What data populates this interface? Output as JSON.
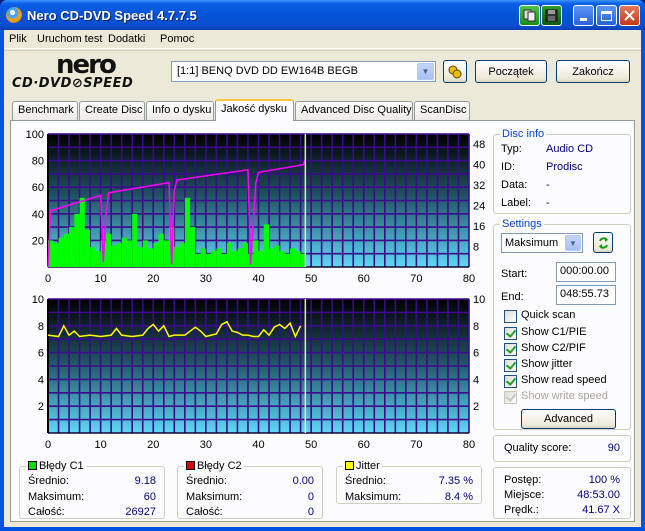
{
  "window": {
    "title": "Nero CD-DVD Speed 4.7.7.5",
    "buttons": [
      "copy",
      "save",
      "minimize",
      "maximize",
      "close"
    ]
  },
  "menu": [
    "Plik",
    "Uruchom test",
    "Dodatki",
    "Pomoc"
  ],
  "logo": {
    "brand": "nero",
    "product": "CD·DVD⊘SPEED"
  },
  "toolbar": {
    "drive": "[1:1]  BENQ DVD DD EW164B BEGB",
    "start_label": "Początek",
    "exit_label": "Zakończ"
  },
  "tabs": [
    {
      "label": "Benchmark",
      "active": false
    },
    {
      "label": "Create Disc",
      "active": false
    },
    {
      "label": "Info o dysku",
      "active": false
    },
    {
      "label": "Jakość dysku",
      "active": true
    },
    {
      "label": "Advanced Disc Quality",
      "active": false
    },
    {
      "label": "ScanDisc",
      "active": false
    }
  ],
  "disc_info": {
    "title": "Disc info",
    "rows": [
      {
        "label": "Typ:",
        "value": "Audio CD"
      },
      {
        "label": "ID:",
        "value": "Prodisc"
      },
      {
        "label": "Data:",
        "value": "-"
      },
      {
        "label": "Label:",
        "value": "-"
      }
    ]
  },
  "settings": {
    "title": "Settings",
    "speed": "Maksimum",
    "start_label": "Start:",
    "start_value": "000:00.00",
    "end_label": "End:",
    "end_value": "048:55.73",
    "checkboxes": [
      {
        "label": "Quick scan",
        "checked": false,
        "disabled": false
      },
      {
        "label": "Show C1/PIE",
        "checked": true,
        "disabled": false
      },
      {
        "label": "Show C2/PIF",
        "checked": true,
        "disabled": false
      },
      {
        "label": "Show jitter",
        "checked": true,
        "disabled": false
      },
      {
        "label": "Show read speed",
        "checked": true,
        "disabled": false
      },
      {
        "label": "Show write speed",
        "checked": true,
        "disabled": true
      }
    ],
    "advanced_label": "Advanced"
  },
  "quality": {
    "label": "Quality score:",
    "value": "90"
  },
  "progress": {
    "rows": [
      {
        "label": "Postęp:",
        "value": "100 %"
      },
      {
        "label": "Miejsce:",
        "value": "48:53.00"
      },
      {
        "label": "Prędk.:",
        "value": "41.67 X"
      }
    ]
  },
  "stats": {
    "c1": {
      "title": "Błędy C1",
      "color": "#00e000",
      "rows": [
        {
          "label": "Średnio:",
          "value": "9.18"
        },
        {
          "label": "Maksimum:",
          "value": "60"
        },
        {
          "label": "Całość:",
          "value": "26927"
        }
      ]
    },
    "c2": {
      "title": "Błędy C2",
      "color": "#e00000",
      "rows": [
        {
          "label": "Średnio:",
          "value": "0.00"
        },
        {
          "label": "Maksimum:",
          "value": "0"
        },
        {
          "label": "Całość:",
          "value": "0"
        }
      ]
    },
    "jitter": {
      "title": "Jitter",
      "color": "#ffff00",
      "rows": [
        {
          "label": "Średnio:",
          "value": "7.35 %"
        },
        {
          "label": "Maksimum:",
          "value": "8.4 %"
        }
      ]
    }
  },
  "chart_data": [
    {
      "type": "bar",
      "title": "C1 errors / read speed",
      "x_ticks": [
        "0",
        "10",
        "20",
        "30",
        "40",
        "50",
        "60",
        "70",
        "80"
      ],
      "xlim": [
        0,
        80
      ],
      "y_ticks_left": [
        "100",
        "80",
        "60",
        "40",
        "20"
      ],
      "ylim_left": [
        0,
        100
      ],
      "y_ticks_right": [
        "48",
        "40",
        "32",
        "24",
        "16",
        "8"
      ],
      "ylim_right": [
        0,
        52
      ],
      "position_marker": 48.9,
      "series": [
        {
          "name": "C1 errors",
          "color": "#00ff00",
          "axis": "left",
          "x": [
            0,
            1,
            2,
            3,
            4,
            5,
            6,
            7,
            8,
            9,
            10,
            11,
            12,
            13,
            14,
            15,
            16,
            17,
            18,
            19,
            20,
            21,
            22,
            23,
            24,
            25,
            26,
            27,
            28,
            29,
            30,
            31,
            32,
            33,
            34,
            35,
            36,
            37,
            38,
            39,
            40,
            41,
            42,
            43,
            44,
            45,
            46,
            47,
            48
          ],
          "values": [
            20,
            18,
            22,
            25,
            30,
            40,
            52,
            28,
            15,
            12,
            20,
            25,
            16,
            18,
            22,
            20,
            40,
            15,
            20,
            14,
            18,
            25,
            20,
            30,
            15,
            18,
            52,
            30,
            10,
            14,
            10,
            12,
            14,
            10,
            18,
            12,
            14,
            18,
            10,
            20,
            12,
            32,
            14,
            16,
            12,
            10,
            14,
            12,
            10
          ]
        },
        {
          "name": "Read speed (X)",
          "color": "#ff00ff",
          "axis": "right",
          "x": [
            0,
            0.5,
            10,
            10.5,
            11,
            11.5,
            23,
            23.5,
            24,
            24.5,
            38,
            38.5,
            39.5,
            40,
            48.5,
            48.9
          ],
          "values": [
            0,
            22,
            28,
            2,
            20,
            29,
            33,
            1,
            30,
            34,
            38,
            1,
            33,
            37,
            40,
            42
          ]
        }
      ]
    },
    {
      "type": "line",
      "title": "Jitter",
      "x_ticks": [
        "0",
        "10",
        "20",
        "30",
        "40",
        "50",
        "60",
        "70",
        "80"
      ],
      "xlim": [
        0,
        80
      ],
      "y_ticks_left": [
        "10",
        "8",
        "6",
        "4",
        "2"
      ],
      "y_ticks_right": [
        "10",
        "8",
        "6",
        "4",
        "2"
      ],
      "ylim": [
        0,
        10
      ],
      "position_marker": 48.9,
      "series": [
        {
          "name": "Jitter (%)",
          "color": "#ffff00",
          "x": [
            0,
            2,
            3,
            4,
            5,
            6,
            8,
            10,
            12,
            13,
            14,
            16,
            18,
            19,
            20,
            21,
            22,
            23,
            24,
            26,
            28,
            29,
            30,
            32,
            33,
            34,
            35,
            36,
            37,
            38,
            39,
            40,
            41,
            42,
            43,
            44,
            45,
            46,
            47,
            48
          ],
          "values": [
            7.3,
            7.2,
            8.0,
            7.3,
            7.6,
            7.2,
            7.3,
            7.2,
            7.3,
            7.8,
            7.3,
            7.2,
            7.3,
            7.8,
            8.1,
            7.6,
            8.0,
            7.2,
            7.3,
            7.3,
            7.9,
            7.6,
            7.2,
            7.4,
            8.1,
            8.3,
            7.6,
            7.5,
            7.3,
            7.3,
            7.2,
            7.2,
            7.7,
            7.3,
            7.9,
            8.1,
            7.8,
            8.2,
            7.2,
            8.0
          ]
        }
      ]
    }
  ]
}
